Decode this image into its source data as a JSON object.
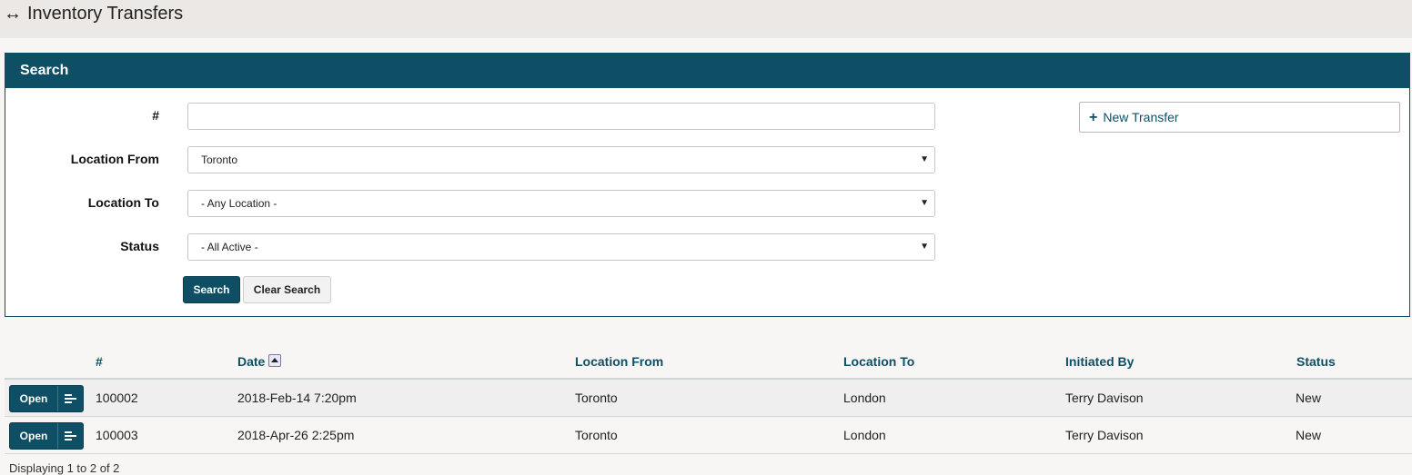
{
  "page": {
    "title_icon": "↔",
    "title": "Inventory Transfers"
  },
  "search": {
    "panel_title": "Search",
    "fields": {
      "number": {
        "label": "#",
        "value": "",
        "placeholder": ""
      },
      "location_from": {
        "label": "Location From",
        "value": "Toronto"
      },
      "location_to": {
        "label": "Location To",
        "value": "- Any Location -"
      },
      "status": {
        "label": "Status",
        "value": "- All Active -"
      }
    },
    "search_button": "Search",
    "clear_button": "Clear Search",
    "new_transfer_icon": "+",
    "new_transfer_button": "New Transfer"
  },
  "table": {
    "columns": [
      "#",
      "Date",
      "Location From",
      "Location To",
      "Initiated By",
      "Status"
    ],
    "open_label": "Open",
    "rows": [
      {
        "number": "100002",
        "date": "2018-Feb-14 7:20pm",
        "from": "Toronto",
        "to": "London",
        "initiated_by": "Terry Davison",
        "status": "New"
      },
      {
        "number": "100003",
        "date": "2018-Apr-26 2:25pm",
        "from": "Toronto",
        "to": "London",
        "initiated_by": "Terry Davison",
        "status": "New"
      }
    ],
    "footer": "Displaying 1 to 2 of 2"
  },
  "colors": {
    "primary": "#0e4f66",
    "header_bg": "#ece8e5",
    "page_bg": "#f7f6f4"
  }
}
